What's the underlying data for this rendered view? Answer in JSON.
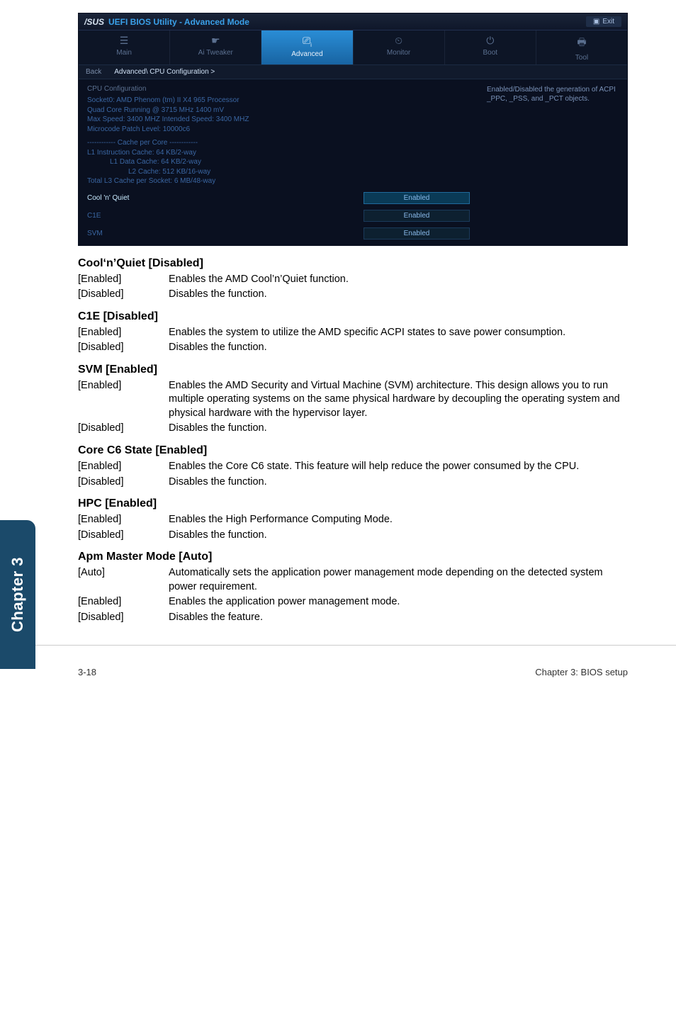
{
  "bios": {
    "brand": "/SUS",
    "title": "UEFI BIOS Utility - Advanced Mode",
    "exit_label": "Exit",
    "tabs": {
      "main": "Main",
      "ai_tweaker": "Ai Tweaker",
      "advanced": "Advanced",
      "monitor": "Monitor",
      "boot": "Boot",
      "tool": "Tool"
    },
    "breadcrumb": {
      "back": "Back",
      "path": "Advanced\\ CPU Configuration  >"
    },
    "section_title": "CPU Configuration",
    "cpu_info": {
      "socket": "Socket0: AMD Phenom (tm) II X4 965 Processor",
      "running": "Quad Core Running @ 3715 MHz 1400 mV",
      "speed": "Max Speed: 3400 MHZ   Intended Speed: 3400 MHZ",
      "microcode": "Microcode Patch Level: 10000c6",
      "cache_header": "------------  Cache per Core  ------------",
      "l1i": "L1 Instruction Cache:  64 KB/2-way",
      "l1d": "L1 Data Cache:  64 KB/2-way",
      "l2": "L2 Cache:  512 KB/16-way",
      "l3": "Total L3 Cache per Socket: 6 MB/48-way"
    },
    "fields": {
      "cool": {
        "label": "Cool 'n' Quiet",
        "value": "Enabled"
      },
      "c1e": {
        "label": "C1E",
        "value": "Enabled"
      },
      "svm": {
        "label": "SVM",
        "value": "Enabled"
      }
    },
    "help_text": "Enabled/Disabled the generation of ACPI _PPC, _PSS, and _PCT objects."
  },
  "sections": {
    "cool": {
      "title": "Cool‘n’Quiet [Disabled]",
      "rows": [
        {
          "key": "[Enabled]",
          "val": "Enables the AMD Cool’n’Quiet function."
        },
        {
          "key": "[Disabled]",
          "val": "Disables the function."
        }
      ]
    },
    "c1e": {
      "title": "C1E [Disabled]",
      "rows": [
        {
          "key": "[Enabled]",
          "val": "Enables the system to utilize the AMD specific ACPI states to save power consumption."
        },
        {
          "key": "[Disabled]",
          "val": "Disables the function."
        }
      ]
    },
    "svm": {
      "title": "SVM [Enabled]",
      "rows": [
        {
          "key": "[Enabled]",
          "val": "Enables the AMD Security and Virtual Machine (SVM) architecture. This design allows you to run multiple operating systems on the same physical hardware by decoupling the operating system and physical hardware with the hypervisor layer."
        },
        {
          "key": "[Disabled]",
          "val": "Disables the function."
        }
      ]
    },
    "c6": {
      "title": "Core C6 State [Enabled]",
      "rows": [
        {
          "key": "[Enabled]",
          "val": "Enables the Core C6 state. This feature will help reduce the power consumed by the CPU."
        },
        {
          "key": "[Disabled]",
          "val": "Disables the function."
        }
      ]
    },
    "hpc": {
      "title": "HPC [Enabled]",
      "rows": [
        {
          "key": "[Enabled]",
          "val": "Enables the High Performance Computing Mode."
        },
        {
          "key": "[Disabled]",
          "val": "Disables the function."
        }
      ]
    },
    "apm": {
      "title": "Apm Master Mode [Auto]",
      "rows": [
        {
          "key": "[Auto]",
          "val": "Automatically sets the application power management mode depending on the detected system power requirement."
        },
        {
          "key": "[Enabled]",
          "val": "Enables the application power management mode."
        },
        {
          "key": "[Disabled]",
          "val": "Disables the feature."
        }
      ]
    }
  },
  "spine": "Chapter 3",
  "footer": {
    "left": "3-18",
    "right": "Chapter 3: BIOS setup"
  }
}
